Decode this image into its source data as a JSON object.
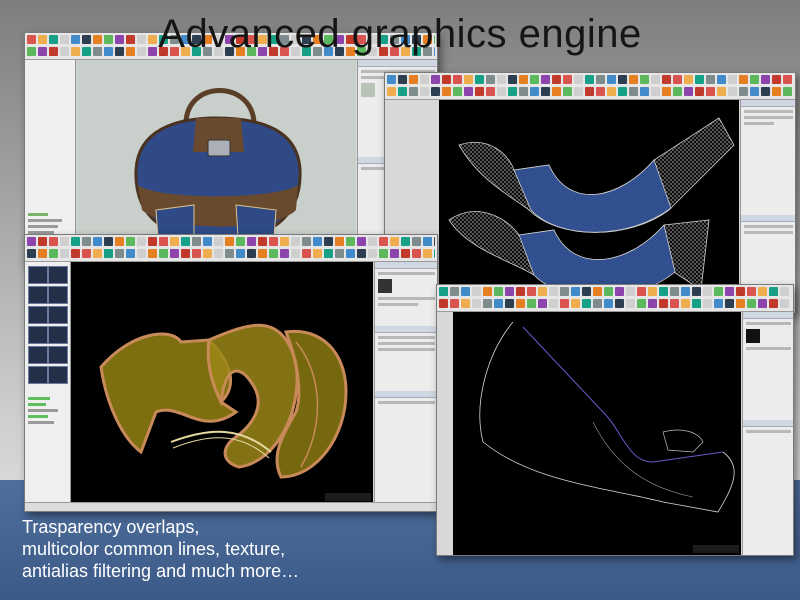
{
  "slide": {
    "title": "Advanced graphics engine",
    "caption_lines": [
      "Trasparency overlaps,",
      "multicolor common lines, texture,",
      "antialias filtering and much more…"
    ]
  },
  "windows": [
    {
      "name": "bag-design-window",
      "canvas_background": "#c9d0cb"
    },
    {
      "name": "shoe-texture-window",
      "canvas_background": "#000000"
    },
    {
      "name": "transparency-overlap-window",
      "canvas_background": "#000000"
    },
    {
      "name": "antialias-line-window",
      "canvas_background": "#000000"
    }
  ],
  "colors": {
    "bag_leather": "#6a4a2e",
    "bag_denim": "#2f4a86",
    "piece_fill": "#8b7a12",
    "piece_edge": "#c98a5a",
    "coord_text": "#39d139",
    "band": "#3c5a88"
  },
  "icons": [
    "toolbar-icon-strip",
    "layer-thumbnail-icon"
  ]
}
